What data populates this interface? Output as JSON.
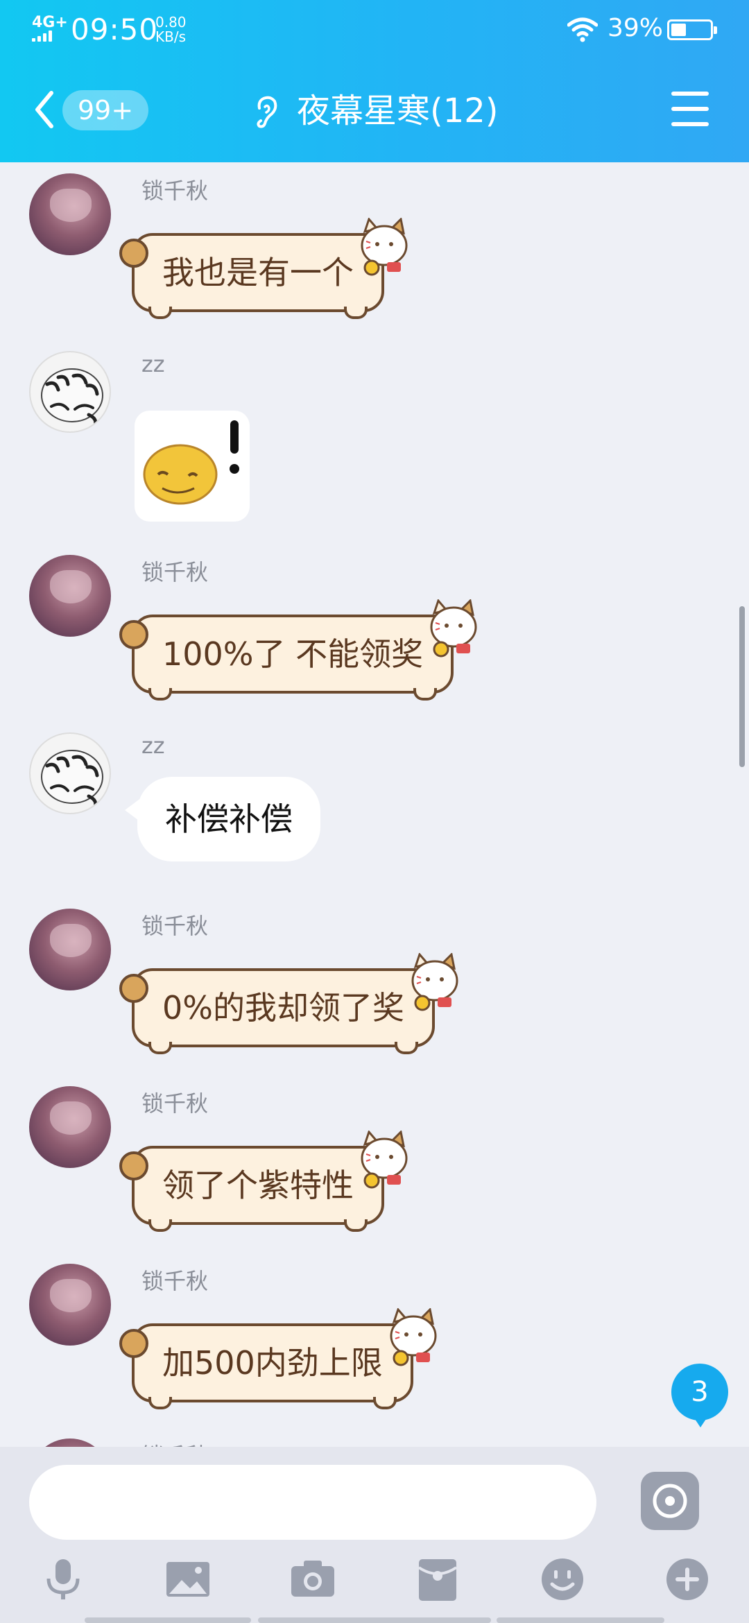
{
  "status_bar": {
    "network": "4G+",
    "time": "09:50",
    "speed_value": "0.80",
    "speed_unit": "KB/s",
    "battery_percent_text": "39%",
    "battery_level": 0.39
  },
  "header": {
    "unread_badge": "99+",
    "title": "夜幕星寒(12)"
  },
  "messages": [
    {
      "sender": "锁千秋",
      "type": "text",
      "bubble": "cat",
      "text": "我也是有一个"
    },
    {
      "sender": "zz",
      "type": "sticker",
      "bubble": "image",
      "sticker": "smiley-exclamation-sticker"
    },
    {
      "sender": "锁千秋",
      "type": "text",
      "bubble": "cat",
      "text": "100%了 不能领奖"
    },
    {
      "sender": "zz",
      "type": "text",
      "bubble": "white",
      "text": "补偿补偿"
    },
    {
      "sender": "锁千秋",
      "type": "text",
      "bubble": "cat",
      "text": "0%的我却领了奖"
    },
    {
      "sender": "锁千秋",
      "type": "text",
      "bubble": "cat",
      "text": "领了个紫特性"
    },
    {
      "sender": "锁千秋",
      "type": "text",
      "bubble": "cat",
      "text": "加500内劲上限"
    },
    {
      "sender": "锁千秋",
      "type": "partial"
    }
  ],
  "unread_new_count": "3",
  "input": {
    "value": "",
    "placeholder": ""
  },
  "toolbar": {
    "icons": [
      "microphone-icon",
      "image-icon",
      "camera-icon",
      "red-packet-icon",
      "emoji-icon",
      "plus-icon"
    ]
  },
  "colors": {
    "header_start": "#12c8f2",
    "header_end": "#30a8f4",
    "chat_bg": "#eef0f6",
    "cat_bubble_bg": "#fdf1df",
    "cat_bubble_text": "#5a3820",
    "unread_badge": "#16aaee"
  }
}
